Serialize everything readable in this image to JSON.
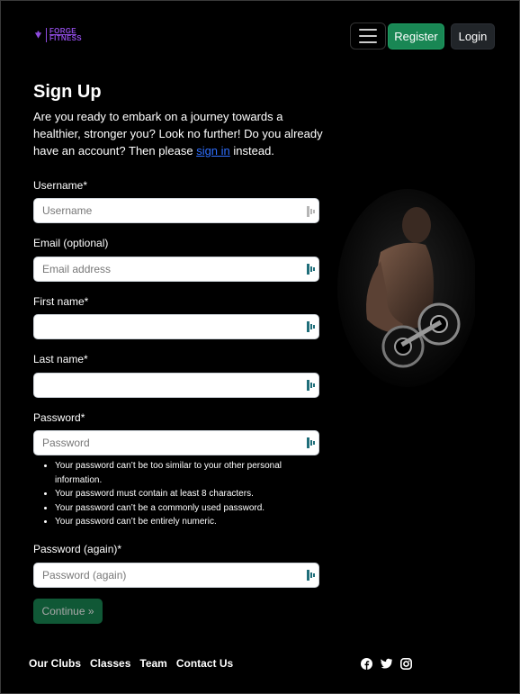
{
  "header": {
    "logo_line1": "FORGE",
    "logo_line2": "FITNESS",
    "register_label": "Register",
    "login_label": "Login"
  },
  "page": {
    "title": "Sign Up",
    "intro_before_link": "Are you ready to embark on a journey towards a healthier, stronger you? Look no further! Do you already have an account? Then please ",
    "intro_link": "sign in",
    "intro_after_link": " instead."
  },
  "form": {
    "username": {
      "label": "Username*",
      "placeholder": "Username",
      "value": ""
    },
    "email": {
      "label": "Email (optional)",
      "placeholder": "Email address",
      "value": ""
    },
    "first_name": {
      "label": "First name*",
      "placeholder": "",
      "value": ""
    },
    "last_name": {
      "label": "Last name*",
      "placeholder": "",
      "value": ""
    },
    "password": {
      "label": "Password*",
      "placeholder": "Password",
      "value": ""
    },
    "password_help": [
      "Your password can’t be too similar to your other personal information.",
      "Your password must contain at least 8 characters.",
      "Your password can’t be a commonly used password.",
      "Your password can’t be entirely numeric."
    ],
    "password_again": {
      "label": "Password (again)*",
      "placeholder": "Password (again)",
      "value": ""
    },
    "continue_label": "Continue »"
  },
  "footer": {
    "links": [
      "Our Clubs",
      "Classes",
      "Team",
      "Contact Us"
    ],
    "social_icons": [
      "facebook-icon",
      "twitter-icon",
      "instagram-icon"
    ]
  },
  "colors": {
    "background": "#000000",
    "brand_purple": "#8f4be0",
    "success_green": "#198754",
    "dark_button": "#212529",
    "link_blue": "#2f6fff"
  }
}
